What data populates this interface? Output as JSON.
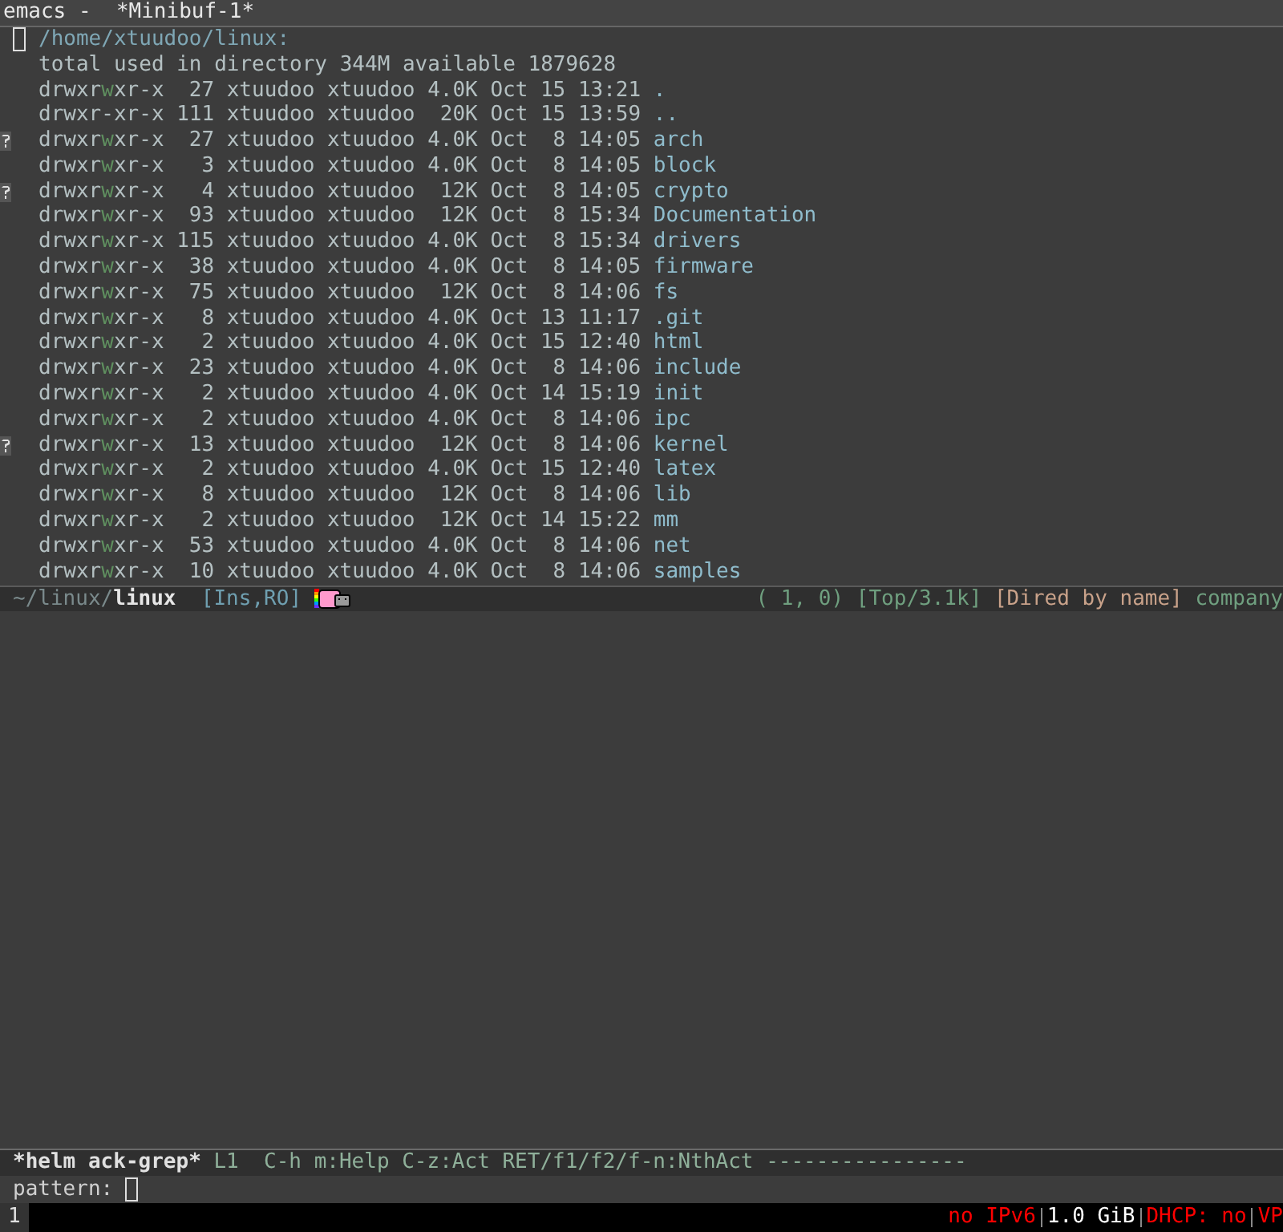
{
  "window": {
    "title": "emacs -  *Minibuf-1*"
  },
  "dired": {
    "header": "/home/xtuudoo/linux:",
    "summary": "total used in directory 344M available 1879628",
    "entries": [
      {
        "perms": "drwxrwxr-x",
        "links": "27",
        "owner": "xtuudoo",
        "group": "xtuudoo",
        "size": "4.0K",
        "month": "Oct",
        "day": "15",
        "time": "13:21",
        "name": ".",
        "flagged": false
      },
      {
        "perms": "drwxr-xr-x",
        "links": "111",
        "owner": "xtuudoo",
        "group": "xtuudoo",
        "size": "20K",
        "month": "Oct",
        "day": "15",
        "time": "13:59",
        "name": "..",
        "flagged": false
      },
      {
        "perms": "drwxrwxr-x",
        "links": "27",
        "owner": "xtuudoo",
        "group": "xtuudoo",
        "size": "4.0K",
        "month": "Oct",
        "day": "8",
        "time": "14:05",
        "name": "arch",
        "flagged": true
      },
      {
        "perms": "drwxrwxr-x",
        "links": "3",
        "owner": "xtuudoo",
        "group": "xtuudoo",
        "size": "4.0K",
        "month": "Oct",
        "day": "8",
        "time": "14:05",
        "name": "block",
        "flagged": false
      },
      {
        "perms": "drwxrwxr-x",
        "links": "4",
        "owner": "xtuudoo",
        "group": "xtuudoo",
        "size": "12K",
        "month": "Oct",
        "day": "8",
        "time": "14:05",
        "name": "crypto",
        "flagged": true
      },
      {
        "perms": "drwxrwxr-x",
        "links": "93",
        "owner": "xtuudoo",
        "group": "xtuudoo",
        "size": "12K",
        "month": "Oct",
        "day": "8",
        "time": "15:34",
        "name": "Documentation",
        "flagged": false
      },
      {
        "perms": "drwxrwxr-x",
        "links": "115",
        "owner": "xtuudoo",
        "group": "xtuudoo",
        "size": "4.0K",
        "month": "Oct",
        "day": "8",
        "time": "15:34",
        "name": "drivers",
        "flagged": false
      },
      {
        "perms": "drwxrwxr-x",
        "links": "38",
        "owner": "xtuudoo",
        "group": "xtuudoo",
        "size": "4.0K",
        "month": "Oct",
        "day": "8",
        "time": "14:05",
        "name": "firmware",
        "flagged": false
      },
      {
        "perms": "drwxrwxr-x",
        "links": "75",
        "owner": "xtuudoo",
        "group": "xtuudoo",
        "size": "12K",
        "month": "Oct",
        "day": "8",
        "time": "14:06",
        "name": "fs",
        "flagged": false
      },
      {
        "perms": "drwxrwxr-x",
        "links": "8",
        "owner": "xtuudoo",
        "group": "xtuudoo",
        "size": "4.0K",
        "month": "Oct",
        "day": "13",
        "time": "11:17",
        "name": ".git",
        "flagged": false
      },
      {
        "perms": "drwxrwxr-x",
        "links": "2",
        "owner": "xtuudoo",
        "group": "xtuudoo",
        "size": "4.0K",
        "month": "Oct",
        "day": "15",
        "time": "12:40",
        "name": "html",
        "flagged": false
      },
      {
        "perms": "drwxrwxr-x",
        "links": "23",
        "owner": "xtuudoo",
        "group": "xtuudoo",
        "size": "4.0K",
        "month": "Oct",
        "day": "8",
        "time": "14:06",
        "name": "include",
        "flagged": false
      },
      {
        "perms": "drwxrwxr-x",
        "links": "2",
        "owner": "xtuudoo",
        "group": "xtuudoo",
        "size": "4.0K",
        "month": "Oct",
        "day": "14",
        "time": "15:19",
        "name": "init",
        "flagged": false
      },
      {
        "perms": "drwxrwxr-x",
        "links": "2",
        "owner": "xtuudoo",
        "group": "xtuudoo",
        "size": "4.0K",
        "month": "Oct",
        "day": "8",
        "time": "14:06",
        "name": "ipc",
        "flagged": false
      },
      {
        "perms": "drwxrwxr-x",
        "links": "13",
        "owner": "xtuudoo",
        "group": "xtuudoo",
        "size": "12K",
        "month": "Oct",
        "day": "8",
        "time": "14:06",
        "name": "kernel",
        "flagged": true
      },
      {
        "perms": "drwxrwxr-x",
        "links": "2",
        "owner": "xtuudoo",
        "group": "xtuudoo",
        "size": "4.0K",
        "month": "Oct",
        "day": "15",
        "time": "12:40",
        "name": "latex",
        "flagged": false
      },
      {
        "perms": "drwxrwxr-x",
        "links": "8",
        "owner": "xtuudoo",
        "group": "xtuudoo",
        "size": "12K",
        "month": "Oct",
        "day": "8",
        "time": "14:06",
        "name": "lib",
        "flagged": false
      },
      {
        "perms": "drwxrwxr-x",
        "links": "2",
        "owner": "xtuudoo",
        "group": "xtuudoo",
        "size": "12K",
        "month": "Oct",
        "day": "14",
        "time": "15:22",
        "name": "mm",
        "flagged": false
      },
      {
        "perms": "drwxrwxr-x",
        "links": "53",
        "owner": "xtuudoo",
        "group": "xtuudoo",
        "size": "4.0K",
        "month": "Oct",
        "day": "8",
        "time": "14:06",
        "name": "net",
        "flagged": false
      },
      {
        "perms": "drwxrwxr-x",
        "links": "10",
        "owner": "xtuudoo",
        "group": "xtuudoo",
        "size": "4.0K",
        "month": "Oct",
        "day": "8",
        "time": "14:06",
        "name": "samples",
        "flagged": false
      }
    ]
  },
  "mode_line": {
    "directory": "~/linux/",
    "buffer": "linux",
    "state": "[Ins,RO]",
    "position": "( 1, 0)",
    "scroll": "[Top/3.1k]",
    "mode": "[Dired by name]",
    "minor_mode": "company"
  },
  "helm": {
    "buffer": "*helm ack-grep*",
    "line": "L1",
    "help": "C-h m:Help C-z:Act RET/f1/f2/f-n:NthAct",
    "fill": "----------------"
  },
  "minibuffer": {
    "prompt": "pattern:"
  },
  "status_bar": {
    "workspace": "1",
    "items": [
      {
        "text": "no IPv6",
        "color": "#ff0000"
      },
      {
        "text": "1.0 GiB",
        "color": "#ffffff"
      },
      {
        "text": "DHCP: no",
        "color": "#ff0000"
      },
      {
        "text": "VP",
        "color": "#ff0000"
      }
    ]
  }
}
